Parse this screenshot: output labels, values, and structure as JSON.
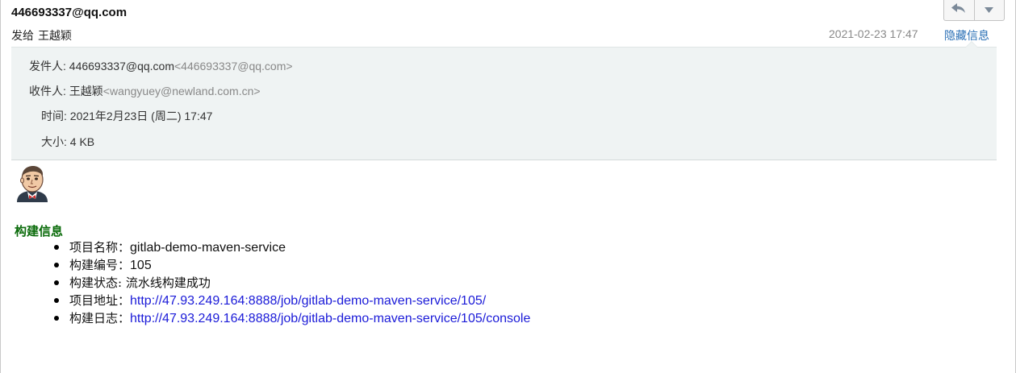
{
  "header": {
    "sender": "446693337@qq.com",
    "to_prefix": "发给",
    "to_name": "王越颖",
    "date": "2021-02-23 17:47",
    "hide_details_label": "隐藏信息",
    "reply_icon": "reply-icon",
    "more_icon": "chevron-down-icon"
  },
  "details": {
    "from_label": "发件人:",
    "from_name": "446693337@qq.com",
    "from_addr": "<446693337@qq.com>",
    "to_label": "收件人:",
    "to_name": "王越颖",
    "to_addr": "<wangyuey@newland.com.cn>",
    "time_label": "时间:",
    "time_value": "2021年2月23日 (周二) 17:47",
    "size_label": "大小:",
    "size_value": "4 KB"
  },
  "body": {
    "heading": "构建信息",
    "items": [
      {
        "key": "项目名称：",
        "value": "gitlab-demo-maven-service"
      },
      {
        "key": "构建编号：",
        "value": "105"
      },
      {
        "key": "构建状态: ",
        "value": "流水线构建成功"
      },
      {
        "key": "项目地址：",
        "value": "http://47.93.249.164:8888/job/gitlab-demo-maven-service/105/"
      },
      {
        "key": "构建日志：",
        "value": "http://47.93.249.164:8888/job/gitlab-demo-maven-service/105/console"
      }
    ]
  },
  "colors": {
    "heading_green": "#0a6b0a",
    "link_blue": "#1a1ad8",
    "detail_bg": "#eff3f3",
    "hide_link_blue": "#2a6fb5"
  }
}
